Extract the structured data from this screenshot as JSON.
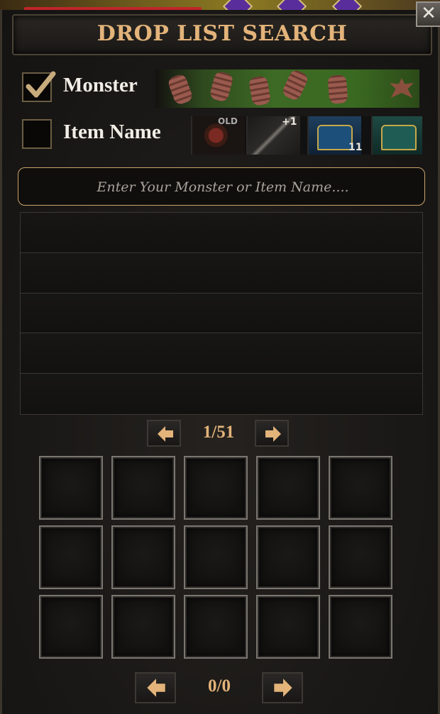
{
  "header": {
    "title": "DROP LIST SEARCH",
    "close_icon": "close-icon"
  },
  "filters": [
    {
      "label": "Monster",
      "checked": true
    },
    {
      "label": "Item Name",
      "checked": false
    }
  ],
  "item_banner": {
    "ring_tag": "OLD",
    "bow_tag": "+1",
    "chest_count": "11"
  },
  "search": {
    "placeholder": "Enter Your Monster or Item Name...."
  },
  "results": {
    "rows": [
      "",
      "",
      "",
      "",
      ""
    ]
  },
  "results_pager": {
    "page": "1/51"
  },
  "drops_pager": {
    "page": "0/0"
  },
  "drop_grid": {
    "rows": 3,
    "cols": 5
  },
  "colors": {
    "accent": "#e3b37a",
    "border_gold": "#c9a46a",
    "text": "#f1ede6"
  }
}
